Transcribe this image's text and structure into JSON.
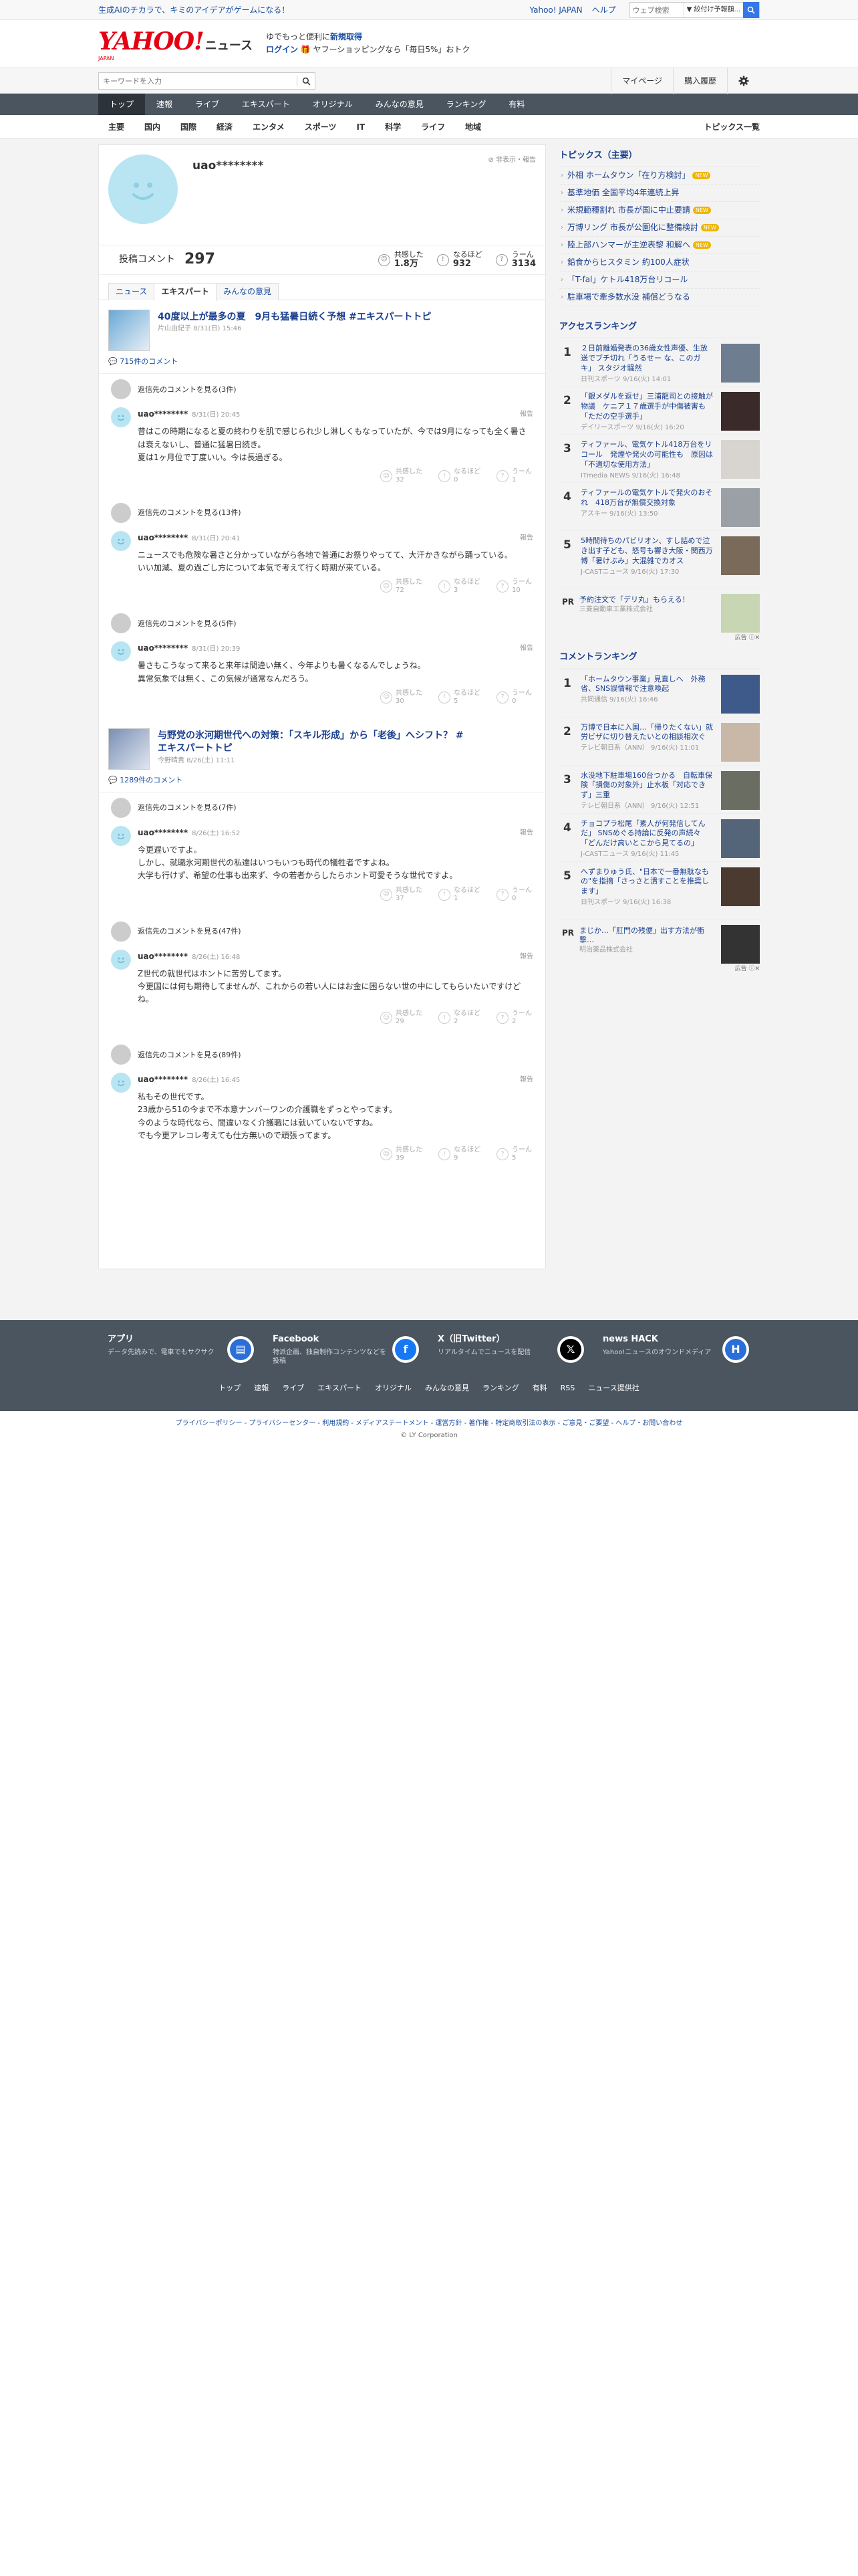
{
  "topbar": {
    "promo": "生成AIのチカラで、キミのアイデアがゲームになる！",
    "links": [
      "Yahoo! JAPAN",
      "ヘルプ"
    ],
    "search_placeholder": "ウェブ検索",
    "search_select": "▼ 絞付け予報額..."
  },
  "logo": {
    "yahoo": "YAHOO!",
    "japan": "JAPAN",
    "news": "ニュース"
  },
  "notice": {
    "line1a": "ゆでもっと便利に",
    "line1b": "新規取得",
    "line2a": "ログイン",
    "line2b": "🎁 ヤフーショッピングなら「毎日5%」おトク"
  },
  "search": {
    "placeholder": "キーワードを入力"
  },
  "rightlinks": [
    "マイページ",
    "購入履歴"
  ],
  "mainnav": [
    "トップ",
    "速報",
    "ライブ",
    "エキスパート",
    "オリジナル",
    "みんなの意見",
    "ランキング",
    "有料"
  ],
  "subnav": [
    "主要",
    "国内",
    "国際",
    "経済",
    "エンタメ",
    "スポーツ",
    "IT",
    "科学",
    "ライフ",
    "地域"
  ],
  "subnav_all": "トピックス一覧",
  "profile": {
    "name": "uao********",
    "hide": "非表示・報告",
    "comment_label": "投稿コメント",
    "comment_count": "297",
    "reactions": [
      {
        "icon": "☺",
        "label": "共感した",
        "value": "1.8万"
      },
      {
        "icon": "!",
        "label": "なるほど",
        "value": "932"
      },
      {
        "icon": "?",
        "label": "うーん",
        "value": "3134"
      }
    ]
  },
  "tabs": [
    "ニュース",
    "エキスパート",
    "みんなの意見"
  ],
  "articles": [
    {
      "title": "40度以上が最多の夏　9月も猛暑日続く予想 #エキスパートトピ",
      "meta": "片山由紀子 8/31(日) 15:46",
      "count": "715件のコメント",
      "threads": [
        {
          "sep": "返信先のコメントを見る(3件)",
          "user": "uao********",
          "date": "8/31(日) 20:45",
          "report": "報告",
          "body": [
            "昔はこの時期になると夏の終わりを肌で感じられ少し淋しくもなっていたが、今では9月になっても全く暑さは衰えないし、普通に猛暑日続き。",
            "夏は1ヶ月位で丁度いい。今は長過ぎる。"
          ],
          "r": [
            "共感した",
            "32",
            "なるほど",
            "0",
            "うーん",
            "1"
          ]
        },
        {
          "sep": "返信先のコメントを見る(13件)",
          "user": "uao********",
          "date": "8/31(日) 20:41",
          "report": "報告",
          "body": [
            "ニュースでも危険な暑さと分かっていながら各地で普通にお祭りやってて、大汗かきながら踊っている。",
            "いい加減、夏の過ごし方について本気で考えて行く時期が来ている。"
          ],
          "r": [
            "共感した",
            "72",
            "なるほど",
            "3",
            "うーん",
            "10"
          ]
        },
        {
          "sep": "返信先のコメントを見る(5件)",
          "user": "uao********",
          "date": "8/31(日) 20:39",
          "report": "報告",
          "body": [
            "暑さもこうなって来ると来年は間違い無く、今年よりも暑くなるんでしょうね。",
            "異常気象では無く、この気候が通常なんだろう。"
          ],
          "r": [
            "共感した",
            "30",
            "なるほど",
            "5",
            "うーん",
            "0"
          ]
        }
      ]
    },
    {
      "title": "与野党の氷河期世代への対策：「スキル形成」から「老後」へシフト？ #エキスパートトピ",
      "meta": "今野晴貴 8/26(土) 11:11",
      "count": "1289件のコメント",
      "threads": [
        {
          "sep": "返信先のコメントを見る(7件)",
          "user": "uao********",
          "date": "8/26(土) 16:52",
          "report": "報告",
          "body": [
            "今更遅いですよ。",
            "しかし、就職氷河期世代の私達はいつもいつも時代の犠牲者ですよね。",
            "大学も行けず、希望の仕事も出来ず、今の若者からしたらホント可愛そうな世代ですよ。"
          ],
          "r": [
            "共感した",
            "37",
            "なるほど",
            "1",
            "うーん",
            "0"
          ]
        },
        {
          "sep": "返信先のコメントを見る(47件)",
          "user": "uao********",
          "date": "8/26(土) 16:48",
          "report": "報告",
          "body": [
            "Z世代の就世代はホントに苦労してます。",
            "今更国には何も期待してませんが、これからの若い人にはお金に困らない世の中にしてもらいたいですけどね。"
          ],
          "r": [
            "共感した",
            "29",
            "なるほど",
            "2",
            "うーん",
            "2"
          ]
        },
        {
          "sep": "返信先のコメントを見る(89件)",
          "user": "uao********",
          "date": "8/26(土) 16:45",
          "report": "報告",
          "body": [
            "私もその世代です。",
            "23歳から51の今まで不本意ナンバーワンの介護職をずっとやってます。",
            "今のような時代なら、間違いなく介護職には就いていないですね。",
            "でも今更アレコレ考えても仕方無いので頑張ってます。"
          ],
          "r": [
            "共感した",
            "39",
            "なるほど",
            "9",
            "うーん",
            "5"
          ]
        }
      ]
    }
  ],
  "side": {
    "topics_head": "トピックス（主要）",
    "topics": [
      {
        "t": "外相 ホームタウン「在り方検討」",
        "new": true
      },
      {
        "t": "基準地価 全国平均4年連続上昇",
        "new": false
      },
      {
        "t": "米規範種割れ 市長が国に中止要請",
        "new": true
      },
      {
        "t": "万博リング 市長が公園化に整備検討",
        "new": true
      },
      {
        "t": "陸上部ハンマーが主逆表黎 和解へ",
        "new": true
      },
      {
        "t": "鉛食からヒスタミン 約100人症状",
        "new": false
      },
      {
        "t": "「T-fal」ケトル418万台リコール",
        "new": false
      },
      {
        "t": "駐車場で牽多数水没 補償どうなる",
        "new": false
      }
    ],
    "new_label": "NEW",
    "access_head": "アクセスランキング",
    "access": [
      {
        "n": "1",
        "t": "２日前離婚発表の36歳女性声優、生放送でブチ切れ「うるせー な、このガキ」 スタジオ騒然",
        "s": "日刊スポーツ 9/16(火) 14:01"
      },
      {
        "n": "2",
        "t": "「銀メダルを返せ」三浦龍司との接触が物議　ケニア１７歳選手が中傷被害も「ただの空手選手」",
        "s": "デイリースポーツ 9/16(火) 16:20"
      },
      {
        "n": "3",
        "t": "ティファール、電気ケトル418万台をリコール　発煙や発火の可能性も　原因は「不適切な使用方法」",
        "s": "ITmedia NEWS 9/16(火) 16:48"
      },
      {
        "n": "4",
        "t": "ティファールの電気ケトルで発火のおそれ　418万台が無償交換対象",
        "s": "アスキー 9/16(火) 13:50"
      },
      {
        "n": "5",
        "t": "5時間待ちのパビリオン、すし詰めで泣き出す子ども、怒号も響き大阪・関西万博「暑けぶみ」大混雑でカオス",
        "s": "J-CASTニュース 9/16(火) 17:30"
      }
    ],
    "pr1": {
      "label": "PR",
      "t": "予約注文で「デリ丸」もらえる！",
      "s": "三菱自動車工業株式会社",
      "ad": "広告"
    },
    "comment_head": "コメントランキング",
    "comments": [
      {
        "n": "1",
        "t": "「ホームタウン事業」見直しへ　外務省、SNS誤情報で注意喚起",
        "s": "共同通信 9/16(火) 16:46"
      },
      {
        "n": "2",
        "t": "万博で日本に入国…「帰りたくない」就労ビザに切り替えたいとの相談相次ぐ",
        "s": "テレビ朝日系（ANN） 9/16(火) 11:01"
      },
      {
        "n": "3",
        "t": "水没地下駐車場160台つかる　自転車保険「損傷の対象外」止水板「対応できず」三重",
        "s": "テレビ朝日系（ANN） 9/16(火) 12:51"
      },
      {
        "n": "4",
        "t": "チョコプラ松尾「素人が何発信してんだ」 SNSめぐる持論に反発の声続々「どんだけ高いとこから見てるの」",
        "s": "J-CASTニュース 9/16(火) 11:45"
      },
      {
        "n": "5",
        "t": "へずまりゅう氏、\"日本で一番無駄なもの\"を指摘「さっさと潰すことを推奨します」",
        "s": "日刊スポーツ 9/16(火) 16:38"
      }
    ],
    "pr2": {
      "label": "PR",
      "t": "まじか…「肛門の残便」出す方法が衝撃…",
      "s": "明治薬品株式会社",
      "ad": "広告"
    }
  },
  "footer": {
    "cards": [
      {
        "title": "アプリ",
        "desc": "データ先読みで、電車でもサクサク"
      },
      {
        "title": "Facebook",
        "desc": "特派企画、独自制作コンテンツなどを投稿"
      },
      {
        "title": "X（旧Twitter）",
        "desc": "リアルタイムでニュースを配信"
      },
      {
        "title": "news HACK",
        "desc": "Yahoo!ニュースのオウンドメディア"
      }
    ],
    "links": [
      "トップ",
      "速報",
      "ライブ",
      "エキスパート",
      "オリジナル",
      "みんなの意見",
      "ランキング",
      "有料",
      "RSS",
      "ニュース提供社"
    ],
    "legal": "プライバシーポリシー - プライバシーセンター - 利用規約 - メディアステートメント - 運営方針 - 著作権 - 特定商取引法の表示 - ご意見・ご要望 - ヘルプ・お問い合わせ",
    "copy": "© LY Corporation"
  }
}
